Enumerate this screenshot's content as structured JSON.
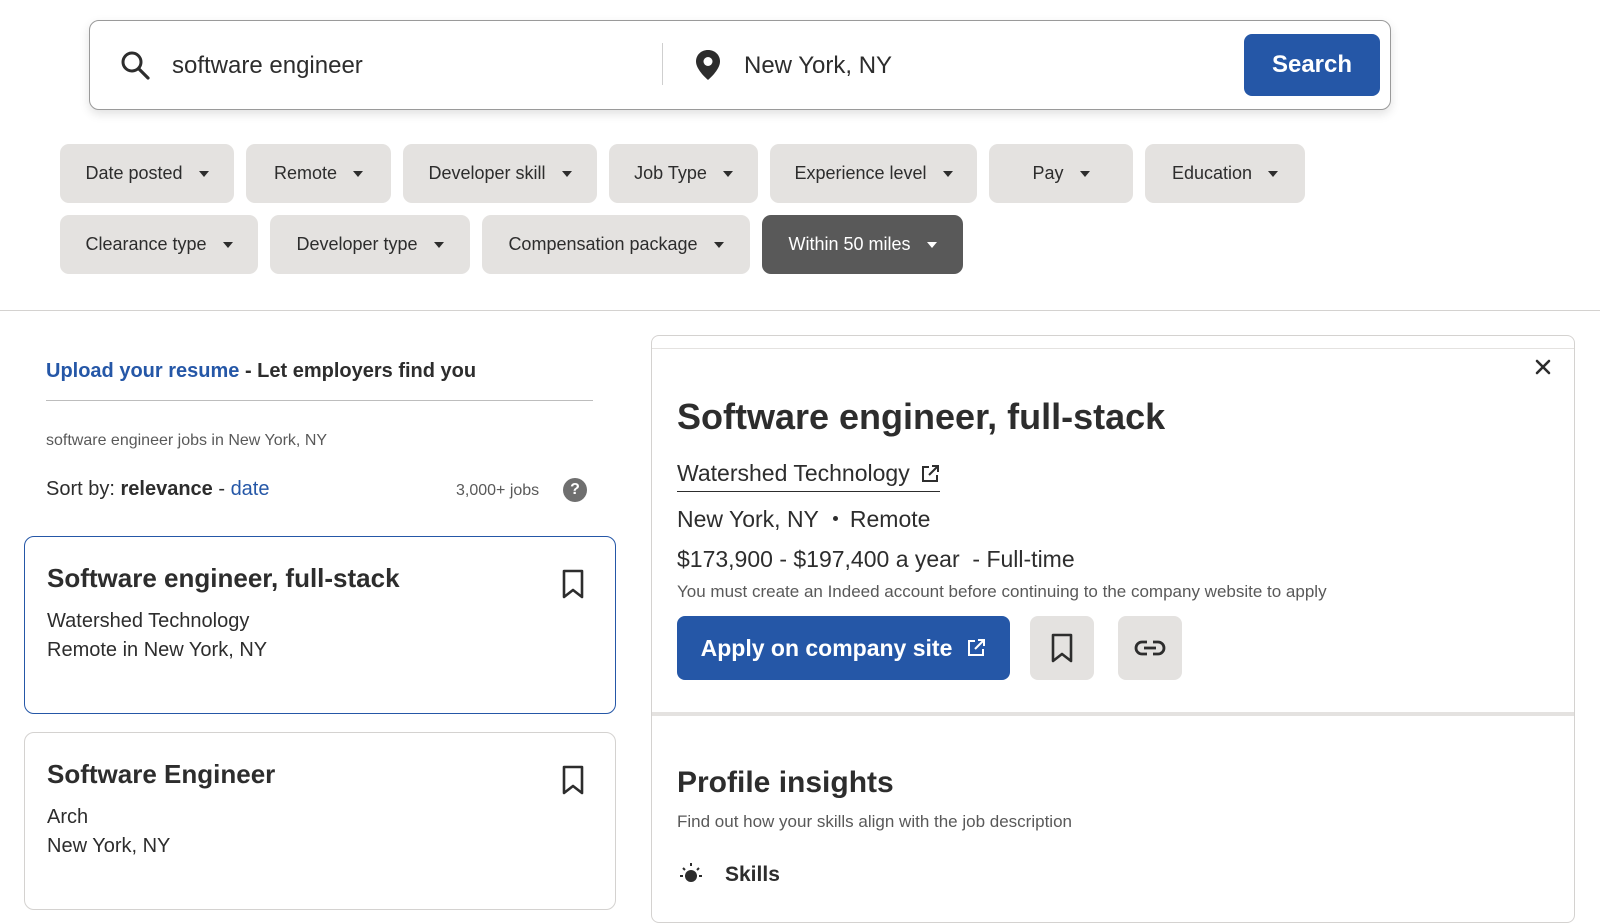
{
  "search": {
    "what_value": "software engineer",
    "where_value": "New York, NY",
    "button_label": "Search"
  },
  "filters": {
    "row1": [
      "Date posted",
      "Remote",
      "Developer skill",
      "Job Type",
      "Experience level",
      "Pay",
      "Education"
    ],
    "row2": [
      "Clearance type",
      "Developer type",
      "Compensation package",
      "Within 50 miles"
    ],
    "active": "Within 50 miles"
  },
  "left": {
    "upload_link": "Upload your resume",
    "upload_rest": " - Let employers find you",
    "jobs_in": "software engineer jobs in New York, NY",
    "sort_prefix": "Sort by: ",
    "sort_relevance": "relevance",
    "sort_sep": " - ",
    "sort_date": "date",
    "job_count": "3,000+ jobs",
    "help_glyph": "?"
  },
  "jobs": [
    {
      "title": "Software engineer, full-stack",
      "company": "Watershed Technology",
      "location": "Remote in New York, NY"
    },
    {
      "title": "Software Engineer",
      "company": "Arch",
      "location": "New York, NY"
    }
  ],
  "detail": {
    "title": "Software engineer, full-stack",
    "company": "Watershed Technology",
    "location": "New York, NY",
    "remote": "Remote",
    "pay": "$173,900 - $197,400 a year",
    "job_type": "- Full-time",
    "note": "You must create an Indeed account before continuing to the company website to apply",
    "apply_label": "Apply on company site",
    "insights_title": "Profile insights",
    "insights_sub": "Find out how your skills align with the job description",
    "skills_label": "Skills"
  },
  "colors": {
    "brand_blue": "#2557a7",
    "chip_bg": "#e4e2e0",
    "chip_active": "#595959"
  },
  "icons": {
    "search": "search-icon",
    "location": "location-pin-icon",
    "bookmark": "bookmark-icon",
    "external": "external-link-icon",
    "link": "link-icon",
    "close": "close-icon",
    "help": "help-icon",
    "skills": "lightbulb-icon"
  }
}
